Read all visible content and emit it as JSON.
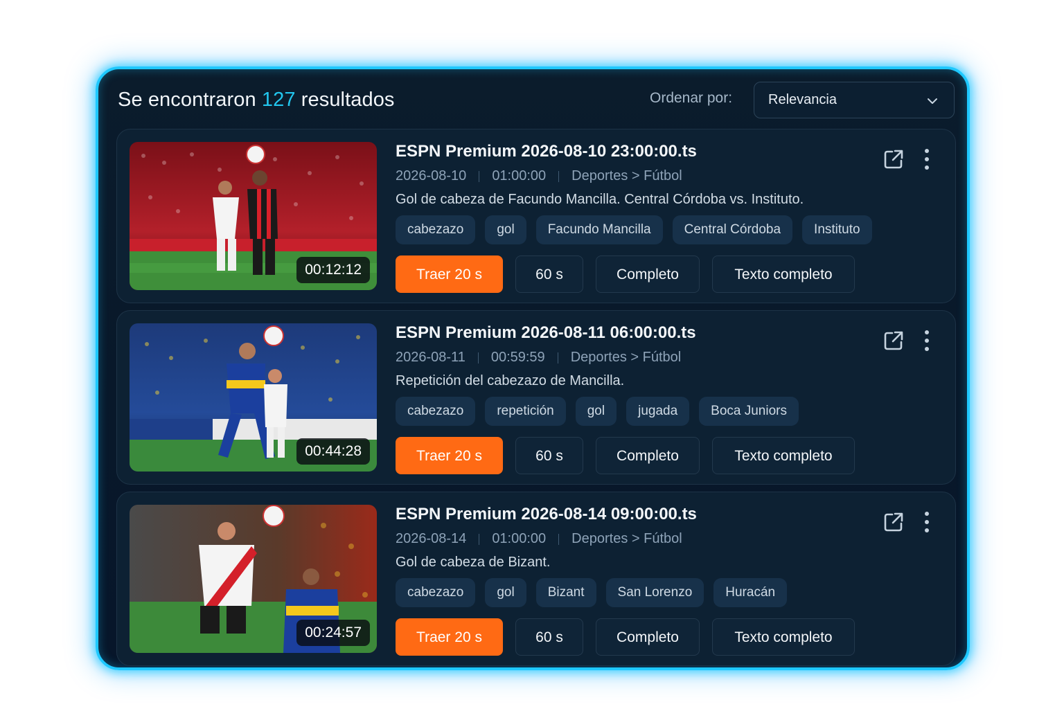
{
  "header": {
    "results_prefix": "Se encontraron",
    "results_count": "127",
    "results_suffix": "resultados",
    "sort_label": "Ordenar por:",
    "sort_value": "Relevancia"
  },
  "icons": {
    "open": "external-link-icon",
    "more": "more-vertical-icon",
    "chevron": "chevron-down-icon"
  },
  "colors": {
    "accent": "#22c6ee",
    "primary_button": "#ff6a14",
    "panel_glow": "#1ec8ff"
  },
  "results": [
    {
      "title": "ESPN Premium 2026-08-10 23:00:00.ts",
      "date": "2026-08-10",
      "length": "01:00:00",
      "category": "Deportes > Fútbol",
      "description": "Gol de cabeza de Facundo Mancilla. Central Córdoba vs. Instituto.",
      "timestamp": "00:12:12",
      "tags": [
        "cabezazo",
        "gol",
        "Facundo Mancilla",
        "Central Córdoba",
        "Instituto"
      ],
      "buttons": {
        "clip20": "Traer 20 s",
        "clip60": "60 s",
        "full": "Completo",
        "fulltext": "Texto completo"
      }
    },
    {
      "title": "ESPN Premium 2026-08-11 06:00:00.ts",
      "date": "2026-08-11",
      "length": "00:59:59",
      "category": "Deportes > Fútbol",
      "description": "Repetición del cabezazo de Mancilla.",
      "timestamp": "00:44:28",
      "tags": [
        "cabezazo",
        "repetición",
        "gol",
        "jugada",
        "Boca Juniors"
      ],
      "buttons": {
        "clip20": "Traer 20 s",
        "clip60": "60 s",
        "full": "Completo",
        "fulltext": "Texto completo"
      }
    },
    {
      "title": "ESPN Premium 2026-08-14 09:00:00.ts",
      "date": "2026-08-14",
      "length": "01:00:00",
      "category": "Deportes > Fútbol",
      "description": "Gol de cabeza de Bizant.",
      "timestamp": "00:24:57",
      "tags": [
        "cabezazo",
        "gol",
        "Bizant",
        "San Lorenzo",
        "Huracán"
      ],
      "buttons": {
        "clip20": "Traer 20 s",
        "clip60": "60 s",
        "full": "Completo",
        "fulltext": "Texto completo"
      }
    }
  ]
}
